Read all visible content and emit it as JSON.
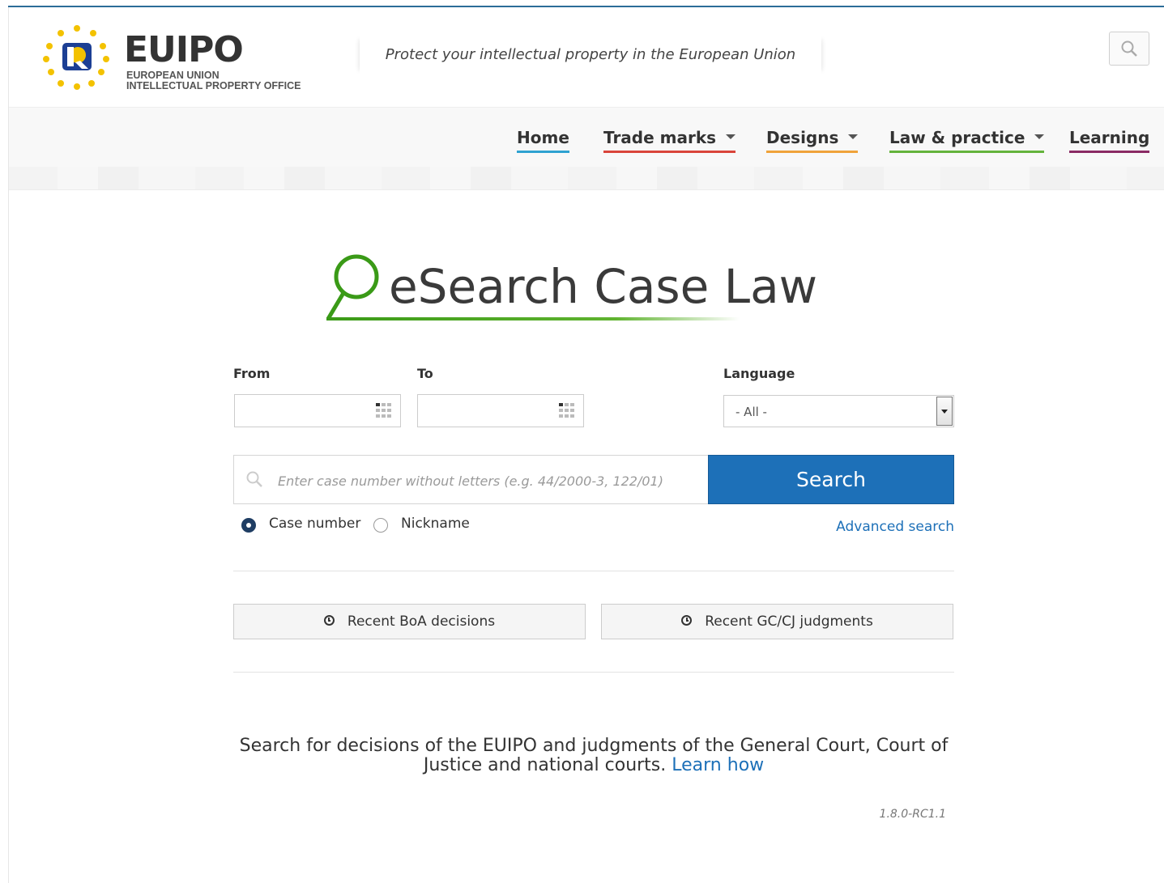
{
  "header": {
    "logo": {
      "main": "EUIPO",
      "line1": "EUROPEAN UNION",
      "line2": "INTELLECTUAL PROPERTY OFFICE",
      "icon": "eu-stars-r-icon"
    },
    "tagline": "Protect your intellectual property in the European Union",
    "search_icon": "search-icon"
  },
  "nav": {
    "items": [
      {
        "label": "Home",
        "color": "#2ea2d1"
      },
      {
        "label": "Trade marks",
        "color": "#d9443a",
        "dropdown": true
      },
      {
        "label": "Designs",
        "color": "#f0a33a",
        "dropdown": true
      },
      {
        "label": "Law & practice",
        "color": "#64b33b",
        "dropdown": true
      },
      {
        "label": "Learning",
        "color": "#8a2a64"
      }
    ]
  },
  "brand": {
    "title": "eSearch Case Law",
    "icon": "magnifier-icon",
    "accent": "#3a9a17"
  },
  "filters": {
    "from_label": "From",
    "to_label": "To",
    "language_label": "Language",
    "language_value": "- All -",
    "from_value": "",
    "to_value": ""
  },
  "search": {
    "placeholder": "Enter case number without letters (e.g. 44/2000-3, 122/01)",
    "button_label": "Search",
    "button_color": "#1d70b8",
    "radio_case": "Case number",
    "radio_nickname": "Nickname",
    "selected": "Case number",
    "advanced_link": "Advanced search"
  },
  "recent": {
    "boa": "Recent BoA decisions",
    "gc": "Recent GC/CJ judgments"
  },
  "info": {
    "text": "Search for decisions of the EUIPO and judgments of the General Court, Court of Justice and national courts.",
    "link": "Learn how"
  },
  "version": "1.8.0-RC1.1"
}
